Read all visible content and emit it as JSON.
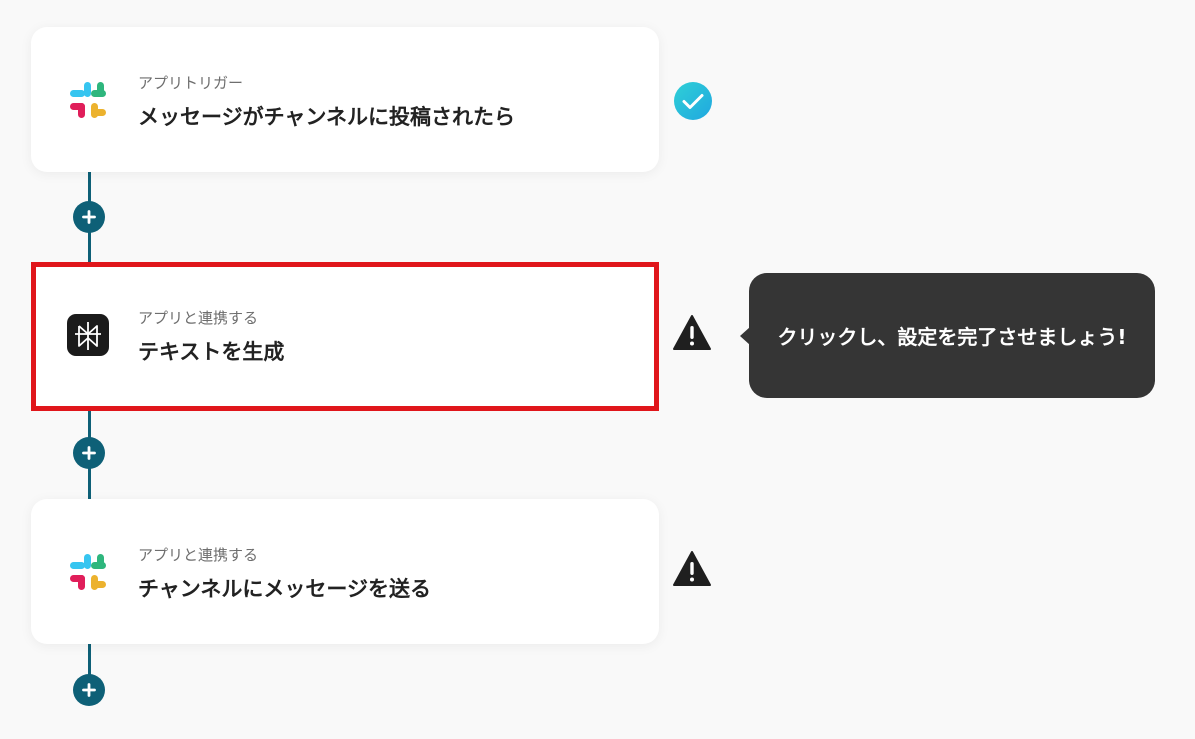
{
  "steps": [
    {
      "kind": "アプリトリガー",
      "title": "メッセージがチャンネルに投稿されたら",
      "app_icon": "slack-icon",
      "status": "complete"
    },
    {
      "kind": "アプリと連携する",
      "title": "テキストを生成",
      "app_icon": "perplexity-icon",
      "status": "warning",
      "highlighted": true
    },
    {
      "kind": "アプリと連携する",
      "title": "チャンネルにメッセージを送る",
      "app_icon": "slack-icon",
      "status": "warning"
    }
  ],
  "tooltip": {
    "text": "クリックし、設定を完了させましょう!"
  },
  "icons": {
    "add": "plus-icon",
    "complete": "check-circle-icon",
    "warning": "warning-triangle-icon"
  },
  "colors": {
    "background": "#f9f9f9",
    "connector": "#0e6077",
    "highlight_border": "#e0161b",
    "complete_check": "#2bc4d9",
    "warning": "#1f1f1f",
    "tooltip_bg": "#353535"
  }
}
